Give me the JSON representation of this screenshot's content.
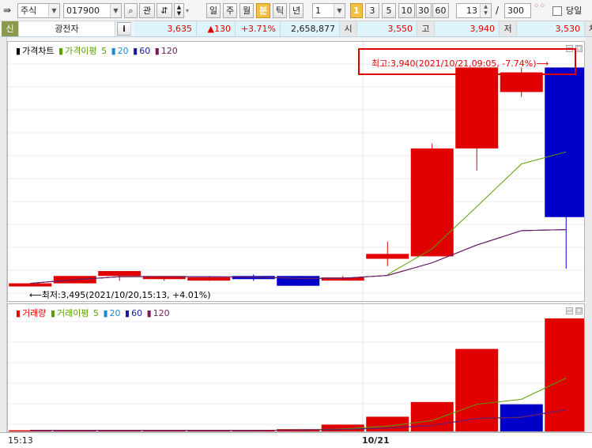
{
  "toolbar": {
    "market": "주식",
    "code": "017900",
    "btn_watch": "관",
    "periods": [
      "일",
      "주",
      "월",
      "분",
      "틱",
      "년"
    ],
    "active_period": "분",
    "interval_value": "1",
    "quick_badge": "1",
    "quick_intervals": [
      "3",
      "5",
      "10",
      "30",
      "60"
    ],
    "count_value": "13",
    "count_sep": "/",
    "total_value": "300",
    "today_label": "당일"
  },
  "quote": {
    "tag": "신",
    "name": "광전자",
    "info_btn": "i",
    "price": "3,635",
    "change": "▲130",
    "change_pct": "+3.71%",
    "volume": "2,658,877",
    "open_label": "시",
    "open": "3,550",
    "high_label": "고",
    "high": "3,940",
    "low_label": "저",
    "low": "3,530",
    "tail_label": "체결강"
  },
  "price_pane": {
    "legend_title": "가격차트",
    "legend_ma_label": "가격이평",
    "ma_periods": [
      "5",
      "20",
      "60",
      "120"
    ],
    "high_annotation": "최고:3,940(2021/10/21,09:05, -7.74%)⟶",
    "low_annotation": "⟵최저:3,495(2021/10/20,15:13, +4.01%)"
  },
  "volume_pane": {
    "legend_title": "거래량",
    "legend_ma_label": "거래이평",
    "ma_periods": [
      "5",
      "20",
      "60",
      "120"
    ]
  },
  "xaxis": {
    "label_left": "15:13",
    "label_mid": "10/21"
  },
  "colors": {
    "up": "#e00000",
    "down": "#0000c8",
    "ma5": "#5aa000",
    "ma20": "#1e88d2",
    "ma60": "#1a1a9a",
    "ma120": "#7a1a5a",
    "annotation_box": "#e00000"
  },
  "chart_data": {
    "type": "candlestick",
    "candles": [
      {
        "o": 3495,
        "h": 3500,
        "l": 3495,
        "c": 3500,
        "dir": "up"
      },
      {
        "o": 3500,
        "h": 3515,
        "l": 3500,
        "c": 3515,
        "dir": "up"
      },
      {
        "o": 3515,
        "h": 3525,
        "l": 3505,
        "c": 3525,
        "dir": "up"
      },
      {
        "o": 3510,
        "h": 3515,
        "l": 3505,
        "c": 3515,
        "dir": "up"
      },
      {
        "o": 3512,
        "h": 3515,
        "l": 3505,
        "c": 3512,
        "dir": "up"
      },
      {
        "o": 3515,
        "h": 3518,
        "l": 3505,
        "c": 3510,
        "dir": "down"
      },
      {
        "o": 3515,
        "h": 3515,
        "l": 3495,
        "c": 3495,
        "dir": "down"
      },
      {
        "o": 3512,
        "h": 3515,
        "l": 3510,
        "c": 3512,
        "dir": "up"
      },
      {
        "o": 3550,
        "h": 3585,
        "l": 3535,
        "c": 3560,
        "dir": "up"
      },
      {
        "o": 3555,
        "h": 3785,
        "l": 3555,
        "c": 3775,
        "dir": "up"
      },
      {
        "o": 3775,
        "h": 3940,
        "l": 3730,
        "c": 3940,
        "dir": "up"
      },
      {
        "o": 3890,
        "h": 3940,
        "l": 3880,
        "c": 3930,
        "dir": "up"
      },
      {
        "o": 3940,
        "h": 3940,
        "l": 3530,
        "c": 3635,
        "dir": "down"
      }
    ],
    "volumes": [
      {
        "v": 1,
        "dir": "up"
      },
      {
        "v": 1,
        "dir": "up"
      },
      {
        "v": 1,
        "dir": "up"
      },
      {
        "v": 1,
        "dir": "up"
      },
      {
        "v": 1,
        "dir": "up"
      },
      {
        "v": 1,
        "dir": "up"
      },
      {
        "v": 2,
        "dir": "up"
      },
      {
        "v": 6,
        "dir": "up"
      },
      {
        "v": 13,
        "dir": "up"
      },
      {
        "v": 26,
        "dir": "up"
      },
      {
        "v": 73,
        "dir": "up"
      },
      {
        "v": 24,
        "dir": "down"
      },
      {
        "v": 100,
        "dir": "up"
      }
    ],
    "price_ylim": [
      3480,
      3960
    ],
    "volume_ylim": [
      0,
      100
    ]
  }
}
